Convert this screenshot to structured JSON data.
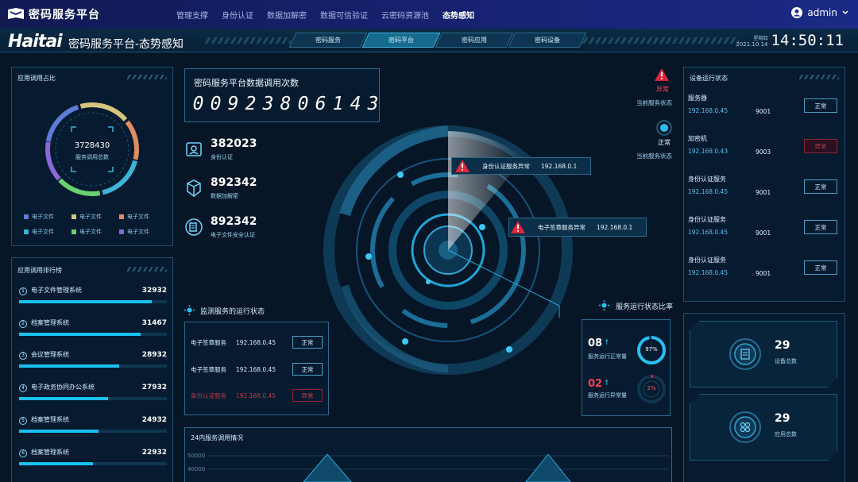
{
  "topnav": {
    "brand": "密码服务平台",
    "items": [
      "管理支撑",
      "身份认证",
      "数据加解密",
      "数据可信验证",
      "云密码资源池",
      "态势感知"
    ],
    "active_index": 5,
    "user": "admin"
  },
  "header": {
    "logo": "Haitai",
    "title": "密码服务平台-态势感知",
    "tabs": [
      "密码服务",
      "密码平台",
      "密码应用",
      "密码设备"
    ],
    "active_tab": 1,
    "weekday": "星期四",
    "date": "2021.10.14",
    "time": "14:50:11"
  },
  "usage_ratio": {
    "title": "应用调用占比",
    "total": "3728430",
    "total_label": "服务调用总数",
    "legend": [
      {
        "label": "电子文件",
        "color": "#5d7bd8"
      },
      {
        "label": "电子文件",
        "color": "#d7c47e"
      },
      {
        "label": "电子文件",
        "color": "#e08d5f"
      },
      {
        "label": "电子文件",
        "color": "#3fb3d7"
      },
      {
        "label": "电子文件",
        "color": "#6ccf72"
      },
      {
        "label": "电子文件",
        "color": "#8c67d8"
      }
    ]
  },
  "ranking": {
    "title": "应用调用排行榜",
    "items": [
      {
        "rank": "1",
        "name": "电子文件管理系统",
        "value": "32932",
        "fill": 0.9
      },
      {
        "rank": "2",
        "name": "档案管理系统",
        "value": "31467",
        "fill": 0.82
      },
      {
        "rank": "3",
        "name": "会议管理系统",
        "value": "28932",
        "fill": 0.68
      },
      {
        "rank": "4",
        "name": "电子政务协同办公系统",
        "value": "27932",
        "fill": 0.6
      },
      {
        "rank": "5",
        "name": "档案管理系统",
        "value": "24932",
        "fill": 0.54
      },
      {
        "rank": "6",
        "name": "档案管理系统",
        "value": "22932",
        "fill": 0.5
      }
    ]
  },
  "call_counter": {
    "title": "密码服务平台数据调用次数",
    "digits": [
      "0",
      "0",
      "9",
      "2",
      "3",
      "8",
      "0",
      "6",
      "1",
      "4",
      "3"
    ]
  },
  "stats": [
    {
      "value": "382023",
      "label": "身份认证",
      "icon": "id-card-icon"
    },
    {
      "value": "892342",
      "label": "数据加解密",
      "icon": "cubes-icon"
    },
    {
      "value": "892342",
      "label": "电子文件安全认证",
      "icon": "file-security-icon"
    }
  ],
  "radar_alerts": [
    {
      "label": "身份认证服务异常",
      "ip": "192.168.0.1"
    },
    {
      "label": "电子签章服务异常",
      "ip": "192.168.0.1"
    }
  ],
  "current_status": {
    "abnormal": "异常",
    "abnormal_caption": "当前服务状态",
    "normal": "正常",
    "normal_caption": "当前服务状态"
  },
  "monitor": {
    "title": "监测服务的运行状态",
    "rows": [
      {
        "name": "电子签章服务",
        "ip": "192.168.0.45",
        "status": "正常",
        "error": false
      },
      {
        "name": "电子签章服务",
        "ip": "192.168.0.45",
        "status": "正常",
        "error": false
      },
      {
        "name": "身份认证服务",
        "ip": "192.168.0.45",
        "status": "异常",
        "error": true
      }
    ]
  },
  "status_ratio": {
    "title": "服务运行状态比率",
    "normal_count": "08",
    "normal_label": "服务运行正常量",
    "normal_pct": "97%",
    "normal_frac": 0.97,
    "abnormal_count": "02",
    "abnormal_label": "服务运行异常量",
    "abnormal_pct": "2%",
    "abnormal_frac": 0.02
  },
  "device_status": {
    "title": "设备运行状态",
    "items": [
      {
        "name": "服务器",
        "ip": "192.168.0.45",
        "port": "9001",
        "status": "正常",
        "error": false
      },
      {
        "name": "加密机",
        "ip": "192.168.0.43",
        "port": "9003",
        "status": "异常",
        "error": true
      },
      {
        "name": "身份认证服务",
        "ip": "192.168.0.45",
        "port": "9001",
        "status": "正常",
        "error": false
      },
      {
        "name": "身份认证服务",
        "ip": "192.168.0.45",
        "port": "9001",
        "status": "正常",
        "error": false
      },
      {
        "name": "身份认证服务",
        "ip": "192.168.0.45",
        "port": "9001",
        "status": "正常",
        "error": false
      }
    ]
  },
  "summary": [
    {
      "value": "29",
      "label": "设备总数"
    },
    {
      "value": "29",
      "label": "应用总数"
    }
  ],
  "hourly_chart": {
    "title": "24内服务调用情况",
    "y_ticks": [
      "50000",
      "40000"
    ]
  }
}
